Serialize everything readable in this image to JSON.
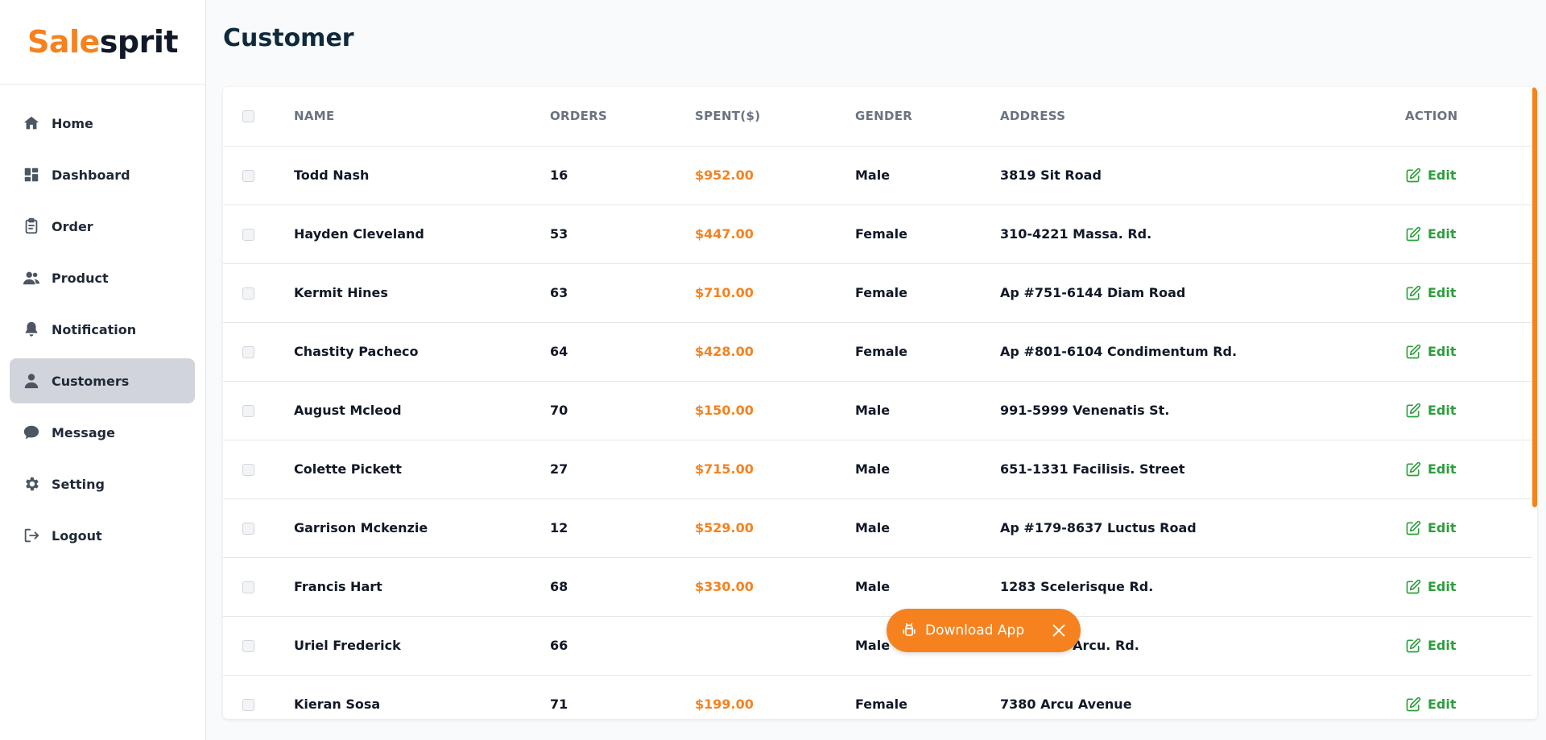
{
  "brand": {
    "part1": "Sale",
    "part2": "sprit"
  },
  "sidebar": {
    "items": [
      {
        "label": "Home",
        "icon": "home-icon"
      },
      {
        "label": "Dashboard",
        "icon": "dashboard-icon"
      },
      {
        "label": "Order",
        "icon": "clipboard-icon"
      },
      {
        "label": "Product",
        "icon": "users-icon"
      },
      {
        "label": "Notification",
        "icon": "bell-icon"
      },
      {
        "label": "Customers",
        "icon": "user-icon",
        "active": true
      },
      {
        "label": "Message",
        "icon": "chat-bubble-icon"
      },
      {
        "label": "Setting",
        "icon": "gear-icon"
      },
      {
        "label": "Logout",
        "icon": "logout-icon"
      }
    ]
  },
  "page": {
    "title": "Customer"
  },
  "table": {
    "headers": {
      "name": "NAME",
      "orders": "ORDERS",
      "spent": "SPENT($)",
      "gender": "GENDER",
      "address": "ADDRESS",
      "action": "ACTION"
    },
    "rows": [
      {
        "name": "Todd Nash",
        "orders": "16",
        "spent": "$952.00",
        "gender": "Male",
        "address": "3819 Sit Road",
        "action": "Edit"
      },
      {
        "name": "Hayden Cleveland",
        "orders": "53",
        "spent": "$447.00",
        "gender": "Female",
        "address": "310-4221 Massa. Rd.",
        "action": "Edit"
      },
      {
        "name": "Kermit Hines",
        "orders": "63",
        "spent": "$710.00",
        "gender": "Female",
        "address": "Ap #751-6144 Diam Road",
        "action": "Edit"
      },
      {
        "name": "Chastity Pacheco",
        "orders": "64",
        "spent": "$428.00",
        "gender": "Female",
        "address": "Ap #801-6104 Condimentum Rd.",
        "action": "Edit"
      },
      {
        "name": "August Mcleod",
        "orders": "70",
        "spent": "$150.00",
        "gender": "Male",
        "address": "991-5999 Venenatis St.",
        "action": "Edit"
      },
      {
        "name": "Colette Pickett",
        "orders": "27",
        "spent": "$715.00",
        "gender": "Male",
        "address": "651-1331 Facilisis. Street",
        "action": "Edit"
      },
      {
        "name": "Garrison Mckenzie",
        "orders": "12",
        "spent": "$529.00",
        "gender": "Male",
        "address": "Ap #179-8637 Luctus Road",
        "action": "Edit"
      },
      {
        "name": "Francis Hart",
        "orders": "68",
        "spent": "$330.00",
        "gender": "Male",
        "address": "1283 Scelerisque Rd.",
        "action": "Edit"
      },
      {
        "name": "Uriel Frederick",
        "orders": "66",
        "spent": "",
        "gender": "Male",
        "address": "655-6831 Arcu. Rd.",
        "action": "Edit"
      },
      {
        "name": "Kieran Sosa",
        "orders": "71",
        "spent": "$199.00",
        "gender": "Female",
        "address": "7380 Arcu Avenue",
        "action": "Edit"
      }
    ]
  },
  "download_banner": {
    "label": "Download App",
    "icon": "android-icon",
    "close_icon": "close-icon"
  },
  "colors": {
    "accent": "#f5821f",
    "edit": "#2e9e3e",
    "title": "#0f2a3d",
    "active_nav": "#d1d5db"
  }
}
